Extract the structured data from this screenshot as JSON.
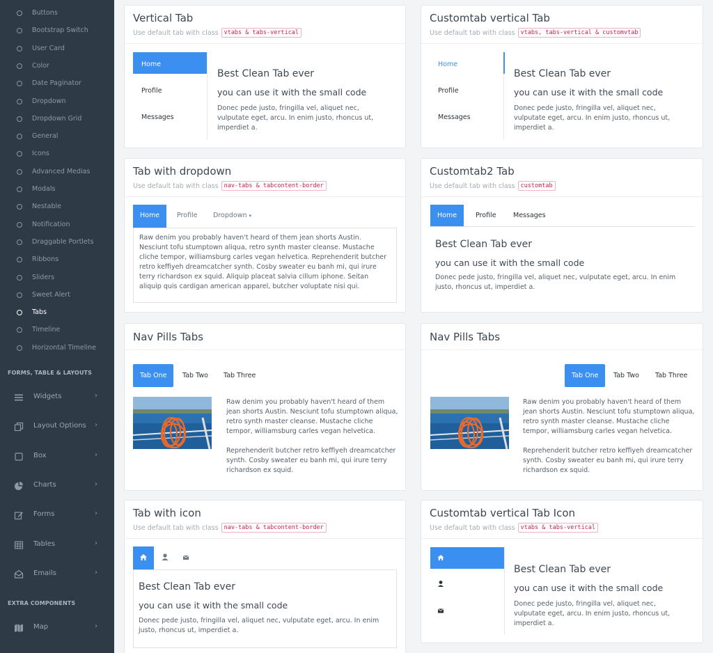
{
  "sidebar": {
    "subitems": [
      "Buttons",
      "Bootstrap Switch",
      "User Card",
      "Color",
      "Date Paginator",
      "Dropdown",
      "Dropdown Grid",
      "General",
      "Icons",
      "Advanced Medias",
      "Modals",
      "Nestable",
      "Notification",
      "Draggable Portlets",
      "Ribbons",
      "Sliders",
      "Sweet Alert",
      "Tabs",
      "Timeline",
      "Horizontal Timeline"
    ],
    "active": "Tabs",
    "section_forms": "FORMS, TABLE & LAYOUTS",
    "forms_items": [
      {
        "label": "Widgets",
        "icon": "menu-icon"
      },
      {
        "label": "Layout Options",
        "icon": "layout-icon"
      },
      {
        "label": "Box",
        "icon": "box-icon"
      },
      {
        "label": "Charts",
        "icon": "pie-chart-icon"
      },
      {
        "label": "Forms",
        "icon": "edit-icon"
      },
      {
        "label": "Tables",
        "icon": "table-icon"
      },
      {
        "label": "Emails",
        "icon": "inbox-icon"
      }
    ],
    "section_extra": "EXTRA COMPONENTS",
    "extra_items": [
      {
        "label": "Map",
        "icon": "map-icon"
      }
    ],
    "chevron": "›"
  },
  "common": {
    "use_default": "Use default tab with class",
    "big_head": "Best Clean Tab ever",
    "sub_head": "you can use it with the small code",
    "lorem_short": "Donec pede justo, fringilla vel, aliquet nec, vulputate eget, arcu. In enim justo, rhoncus ut, imperdiet a.",
    "lorem_long": "Raw denim you probably haven't heard of them jean shorts Austin. Nesciunt tofu stumptown aliqua, retro synth master cleanse. Mustache cliche tempor, williamsburg carles vegan helvetica. Reprehenderit butcher retro keffiyeh dreamcatcher synth. Cosby sweater eu banh mi, qui irure terry richardson ex squid. Aliquip placeat salvia cillum iphone. Seitan aliquip quis cardigan american apparel, butcher voluptate nisi qui.",
    "pill_p1": "Raw denim you probably haven't heard of them jean shorts Austin. Nesciunt tofu stumptown aliqua, retro synth master cleanse. Mustache cliche tempor, williamsburg carles vegan helvetica.",
    "pill_p2": "Reprehenderit butcher retro keffiyeh dreamcatcher synth. Cosby sweater eu banh mi, qui irure terry richardson ex squid."
  },
  "cards": {
    "vertical": {
      "title": "Vertical Tab",
      "code": "vtabs & tabs-vertical",
      "tabs": [
        "Home",
        "Profile",
        "Messages"
      ]
    },
    "customvertical": {
      "title": "Customtab vertical Tab",
      "code": "vtabs, tabs-vertical & customvtab",
      "tabs": [
        "Home",
        "Profile",
        "Messages"
      ]
    },
    "dropdown": {
      "title": "Tab with dropdown",
      "code": "nav-tabs & tabcontent-border",
      "tabs": [
        "Home",
        "Profile",
        "Dropdown"
      ],
      "caret": "▾"
    },
    "customtab2": {
      "title": "Customtab2 Tab",
      "code": "customtab",
      "tabs": [
        "Home",
        "Profile",
        "Messages"
      ]
    },
    "pills1": {
      "title": "Nav Pills Tabs",
      "tabs": [
        "Tab One",
        "Tab Two",
        "Tab Three"
      ]
    },
    "pills2": {
      "title": "Nav Pills Tabs",
      "tabs": [
        "Tab One",
        "Tab Two",
        "Tab Three"
      ]
    },
    "icon": {
      "title": "Tab with icon",
      "code": "nav-tabs & tabcontent-border",
      "icons": [
        "home-icon",
        "user-icon",
        "mail-icon"
      ]
    },
    "iconvertical": {
      "title": "Customtab vertical Tab Icon",
      "code": "vtabs & tabs-vertical",
      "icons": [
        "home-icon",
        "user-icon",
        "mail-icon"
      ]
    }
  },
  "colors": {
    "primary": "#3b8ff0",
    "sidebar": "#2e3a45",
    "code": "#c7254e"
  }
}
